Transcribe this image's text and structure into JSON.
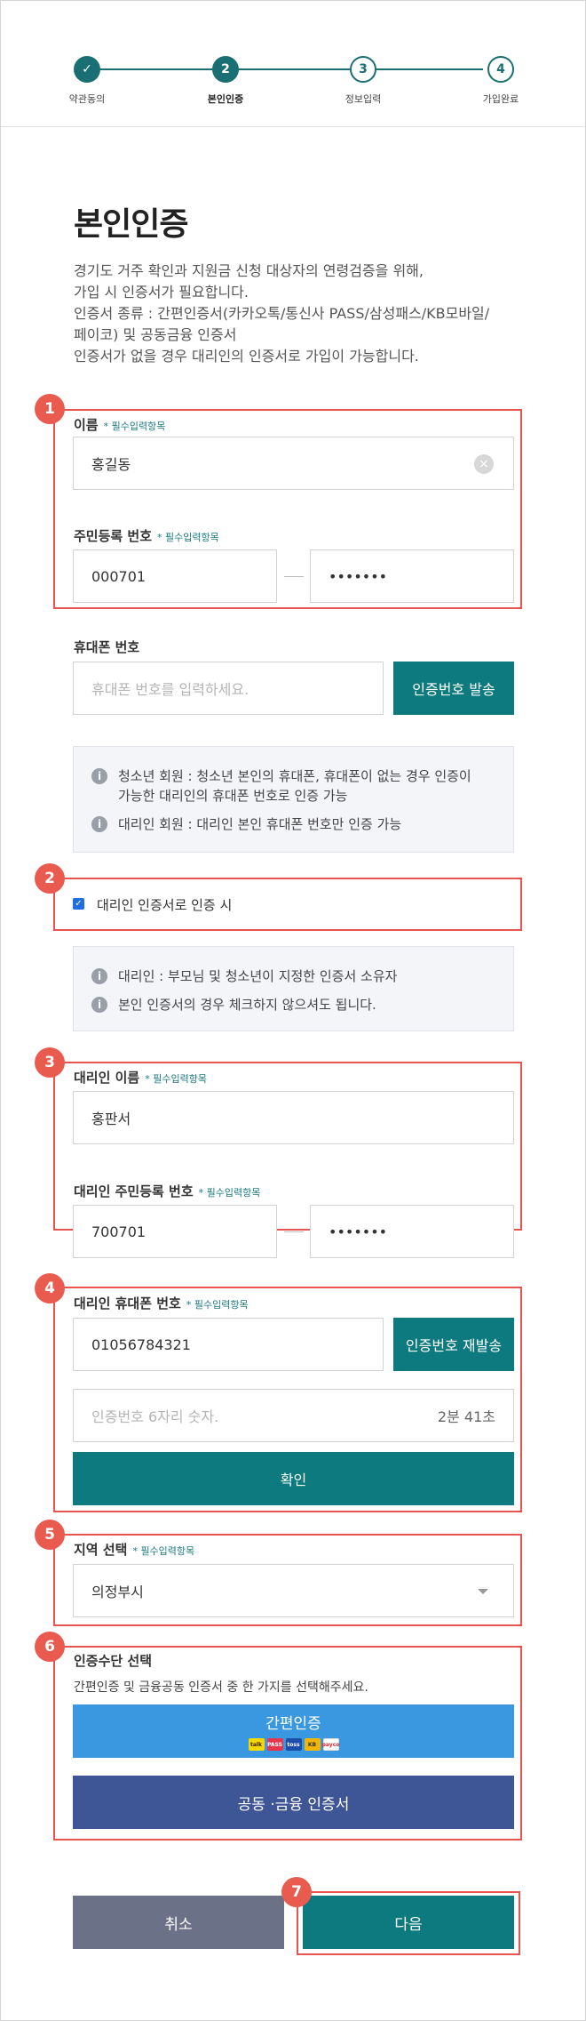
{
  "stepper": {
    "steps": [
      {
        "number": "",
        "label": "약관동의"
      },
      {
        "number": "2",
        "label": "본인인증"
      },
      {
        "number": "3",
        "label": "정보입력"
      },
      {
        "number": "4",
        "label": "가입완료"
      }
    ],
    "active_step": 2
  },
  "page_title": "본인인증",
  "intro_lines": [
    "경기도 거주 확인과 지원금 신청 대상자의 연령검증을 위해,",
    "가입 시 인증서가 필요합니다.",
    "인증서 종류 : 간편인증서(카카오톡/통신사 PASS/삼성패스/KB모바일/",
    "페이코) 및 공동금융 인증서",
    "인증서가 없을 경우 대리인의 인증서로 가입이 가능합니다."
  ],
  "required_mark": "필수입력항목",
  "name_field": {
    "label": "이름",
    "value": "홍길동"
  },
  "rrn_field": {
    "label": "주민등록 번호",
    "front": "000701",
    "back": "•••••••"
  },
  "phone_field": {
    "label": "휴대폰 번호",
    "placeholder": "휴대폰 번호를 입력하세요.",
    "button": "인증번호 발송"
  },
  "info_box_1": [
    "청소년 회원 : 청소년 본인의 휴대폰, 휴대폰이 없는 경우 인증이",
    "가능한 대리인의 휴대폰 번호로 인증 가능",
    "대리인 회원 : 대리인 본인 휴대폰 번호만 인증 가능"
  ],
  "proxy_checkbox": {
    "label": "대리인 인증서로 인증 시",
    "checked": true
  },
  "info_box_2": [
    "대리인 : 부모님 및 청소년이 지정한 인증서 소유자",
    "본인 인증서의 경우 체크하지 않으셔도 됩니다."
  ],
  "proxy_name": {
    "label": "대리인 이름",
    "value": "홍판서"
  },
  "proxy_rrn": {
    "label": "대리인 주민등록 번호",
    "front": "700701",
    "back": "•••••••"
  },
  "proxy_phone": {
    "label": "대리인 휴대폰 번호",
    "value": "01056784321",
    "button": "인증번호 재발송"
  },
  "verify_code": {
    "placeholder": "인증번호 6자리 숫자.",
    "timer": "2분 41초",
    "button": "확인"
  },
  "region": {
    "label": "지역 선택",
    "value": "의정부시"
  },
  "auth_method": {
    "label": "인증수단 선택",
    "description": "간편인증 및 금융공동 인증서 중 한 가지를 선택해주세요.",
    "simple_button": "간편인증",
    "cert_button": "공동 ·금융 인증서",
    "logos": [
      "talk",
      "PASS",
      "toss",
      "KB",
      "payco"
    ]
  },
  "footer": {
    "cancel": "취소",
    "next": "다음"
  },
  "badges": [
    "1",
    "2",
    "3",
    "4",
    "5",
    "6",
    "7"
  ],
  "colors": {
    "accent": "#0d7a80",
    "highlight": "#e8544f",
    "simple_auth": "#3a98e0",
    "cert": "#3f5696",
    "cancel": "#6b7288"
  }
}
